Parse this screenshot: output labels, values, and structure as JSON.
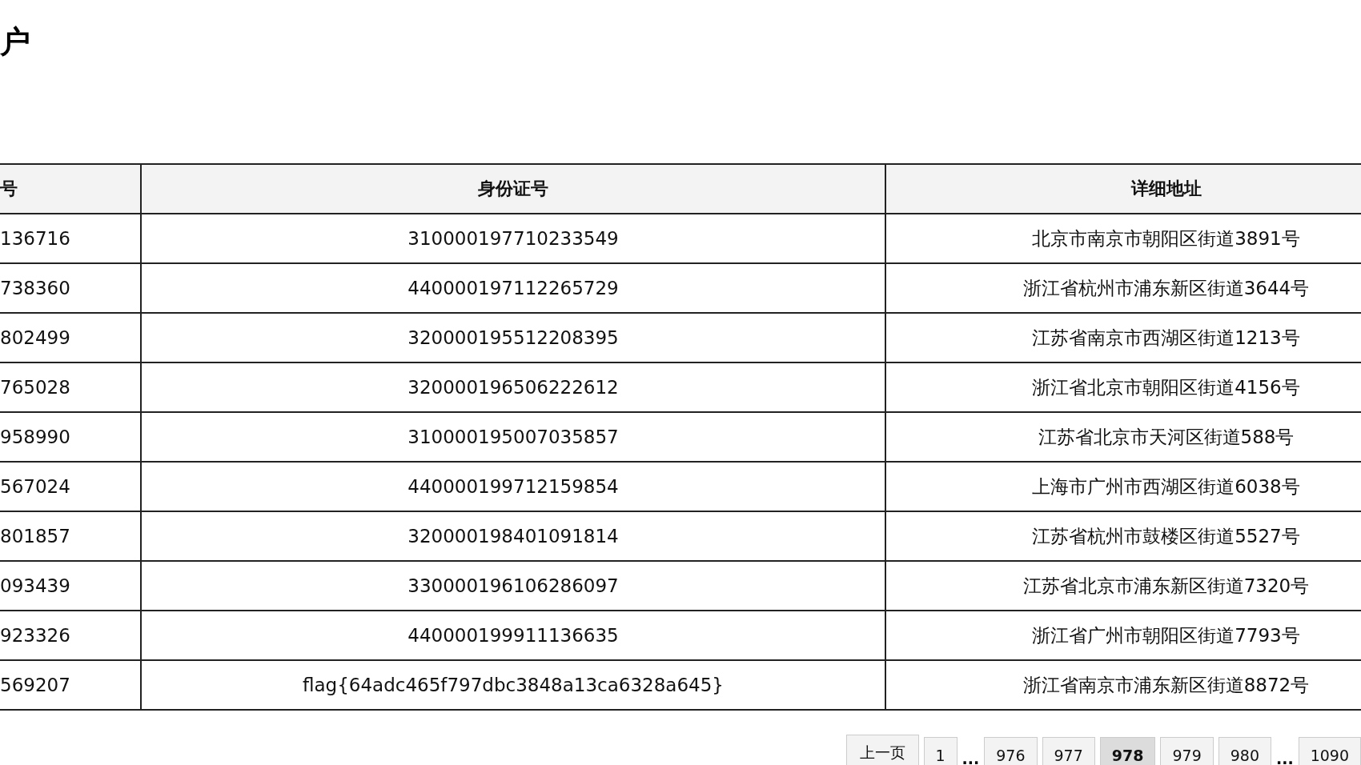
{
  "title": "户",
  "table": {
    "columns": [
      "号",
      "身份证号",
      "详细地址"
    ],
    "rows": [
      [
        "136716",
        "310000197710233549",
        "北京市南京市朝阳区街道3891号"
      ],
      [
        "738360",
        "440000197112265729",
        "浙江省杭州市浦东新区街道3644号"
      ],
      [
        "802499",
        "320000195512208395",
        "江苏省南京市西湖区街道1213号"
      ],
      [
        "765028",
        "320000196506222612",
        "浙江省北京市朝阳区街道4156号"
      ],
      [
        "958990",
        "310000195007035857",
        "江苏省北京市天河区街道588号"
      ],
      [
        "567024",
        "440000199712159854",
        "上海市广州市西湖区街道6038号"
      ],
      [
        "801857",
        "320000198401091814",
        "江苏省杭州市鼓楼区街道5527号"
      ],
      [
        "093439",
        "330000196106286097",
        "江苏省北京市浦东新区街道7320号"
      ],
      [
        "923326",
        "440000199911136635",
        "浙江省广州市朝阳区街道7793号"
      ],
      [
        "569207",
        "flag{64adc465f797dbc3848a13ca6328a645}",
        "浙江省南京市浦东新区街道8872号"
      ]
    ]
  },
  "pagination": [
    {
      "kind": "prev",
      "label": "上一页",
      "selected": false
    },
    {
      "kind": "page",
      "label": "1",
      "selected": false
    },
    {
      "kind": "ellipsis",
      "label": "..."
    },
    {
      "kind": "page",
      "label": "976",
      "selected": false
    },
    {
      "kind": "page",
      "label": "977",
      "selected": false
    },
    {
      "kind": "page",
      "label": "978",
      "selected": true
    },
    {
      "kind": "page",
      "label": "979",
      "selected": false
    },
    {
      "kind": "page",
      "label": "980",
      "selected": false
    },
    {
      "kind": "ellipsis",
      "label": "..."
    },
    {
      "kind": "page",
      "label": "1090",
      "selected": false
    }
  ]
}
